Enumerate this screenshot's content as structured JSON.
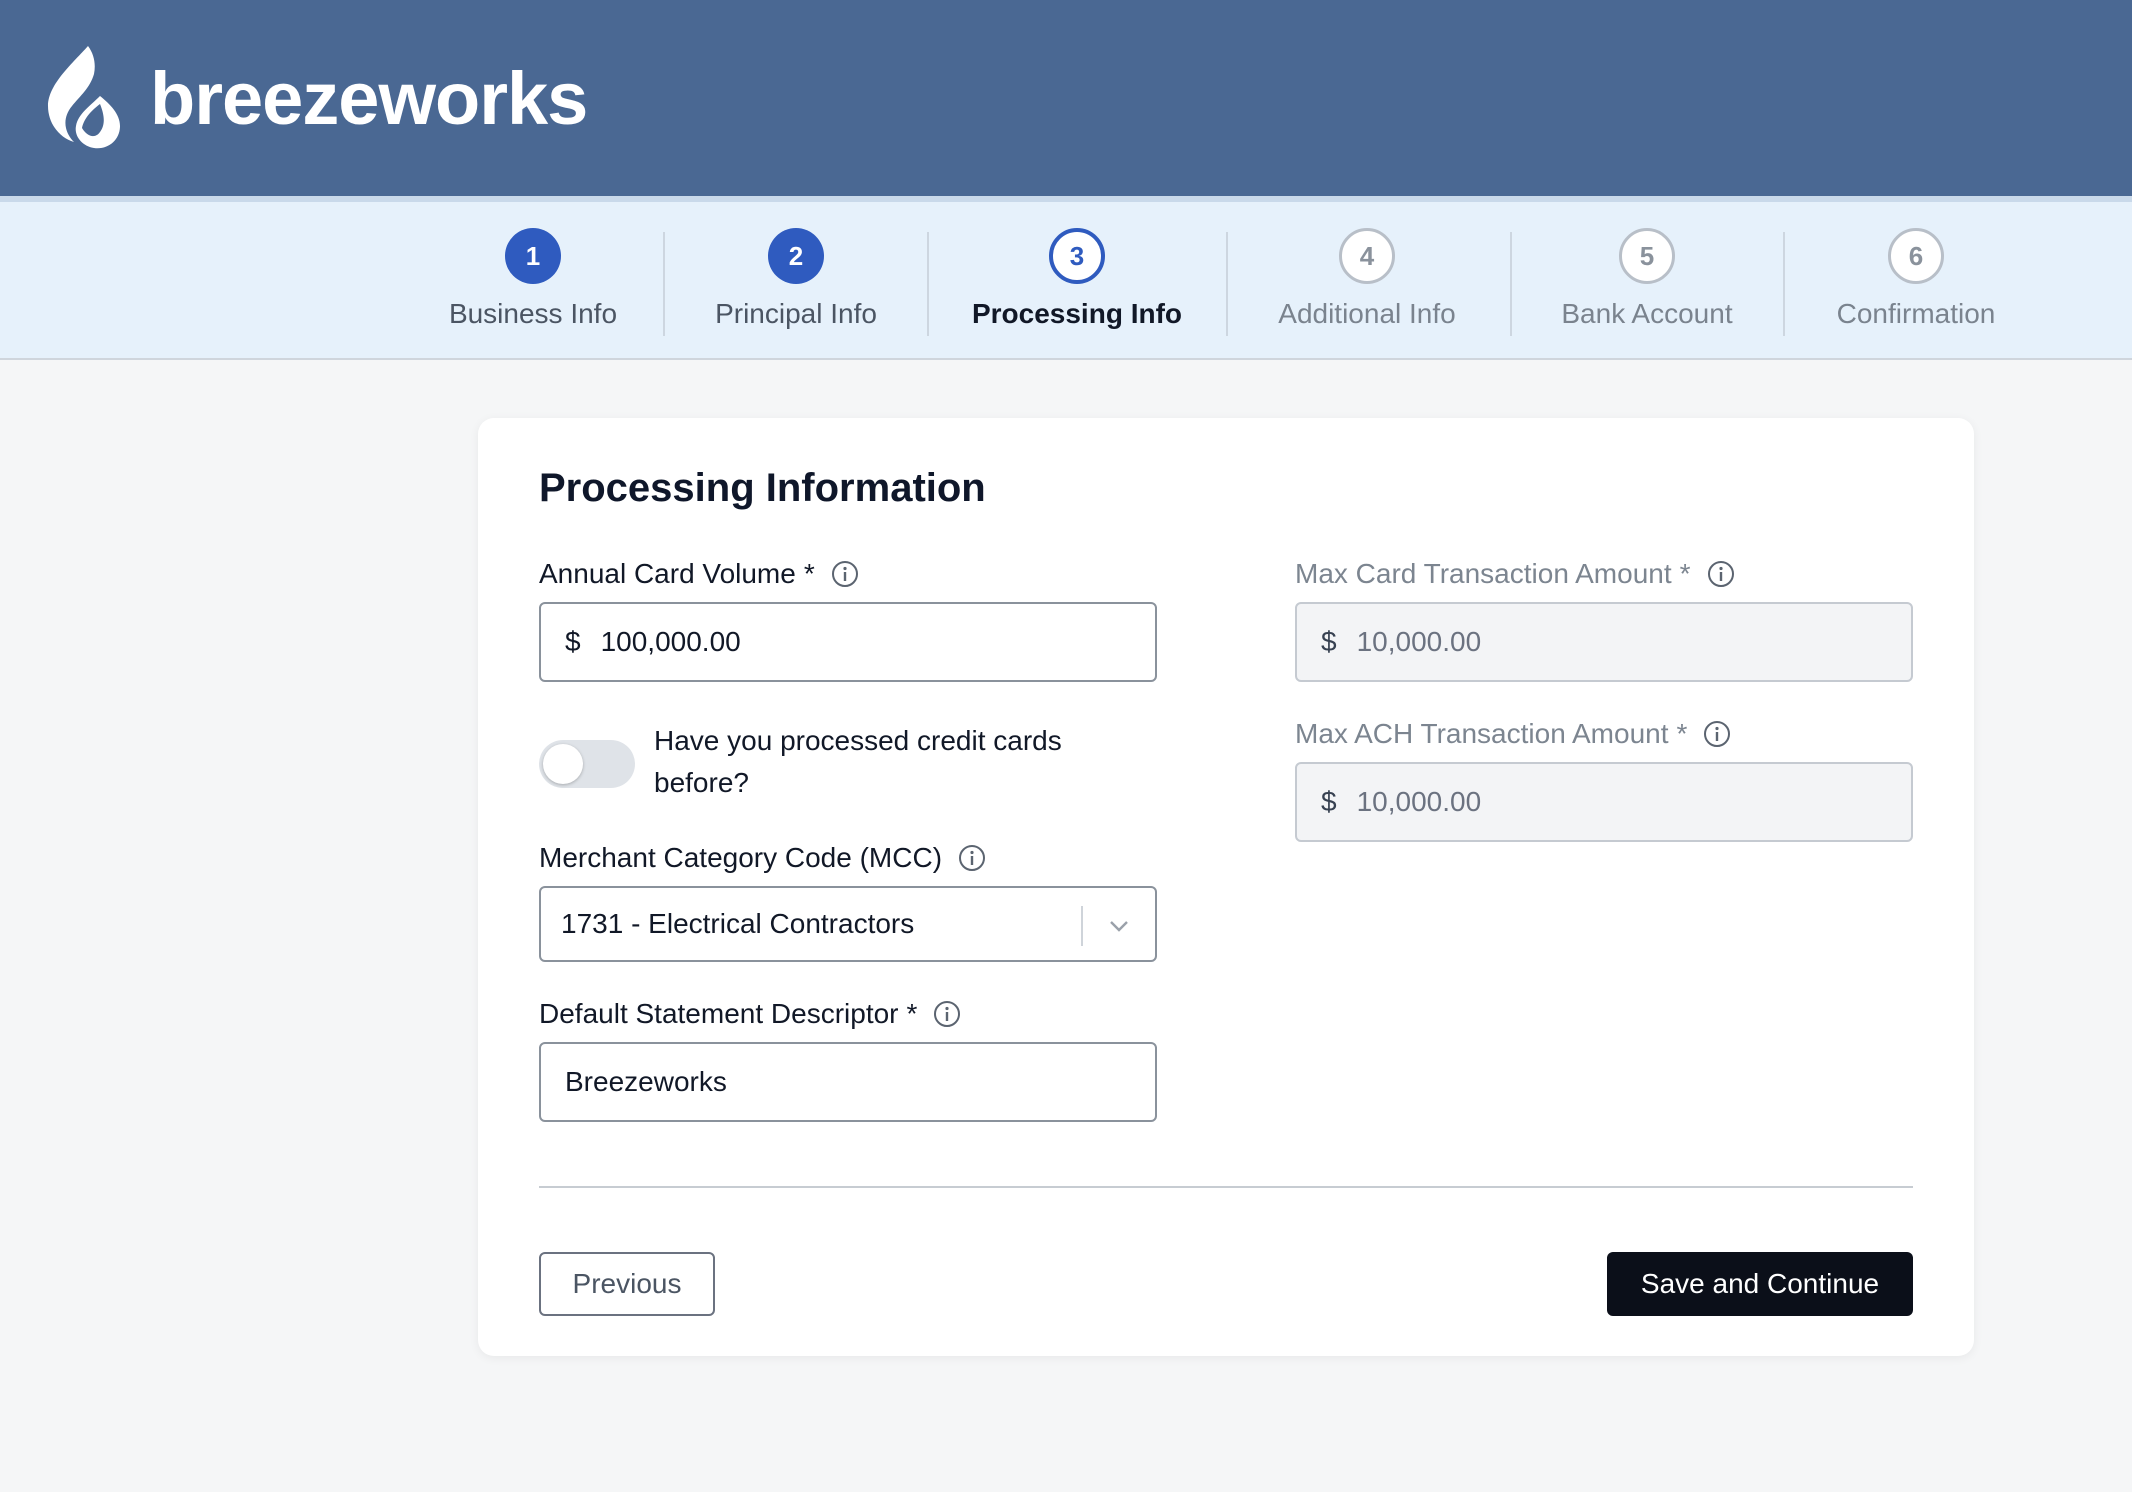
{
  "brand": {
    "name": "breezeworks"
  },
  "stepper": {
    "steps": [
      {
        "number": "1",
        "label": "Business Info",
        "state": "done"
      },
      {
        "number": "2",
        "label": "Principal Info",
        "state": "done"
      },
      {
        "number": "3",
        "label": "Processing Info",
        "state": "current"
      },
      {
        "number": "4",
        "label": "Additional Info",
        "state": "todo"
      },
      {
        "number": "5",
        "label": "Bank Account",
        "state": "todo"
      },
      {
        "number": "6",
        "label": "Confirmation",
        "state": "todo"
      }
    ]
  },
  "form": {
    "title": "Processing Information",
    "annual_card_volume": {
      "label": "Annual Card Volume",
      "required": "*",
      "currency": "$",
      "value": "100,000.00"
    },
    "processed_before": {
      "label": "Have you processed credit cards before?",
      "checked": false
    },
    "mcc": {
      "label": "Merchant Category Code (MCC)",
      "value": "1731 - Electrical Contractors"
    },
    "statement_descriptor": {
      "label": "Default Statement Descriptor",
      "required": "*",
      "value": "Breezeworks"
    },
    "max_card_amount": {
      "label": "Max Card Transaction Amount",
      "required": "*",
      "currency": "$",
      "value": "10,000.00"
    },
    "max_ach_amount": {
      "label": "Max ACH Transaction Amount",
      "required": "*",
      "currency": "$",
      "value": "10,000.00"
    }
  },
  "actions": {
    "previous_label": "Previous",
    "save_label": "Save and Continue"
  },
  "colors": {
    "header": "#4a6893",
    "stepper_bg": "#e6f1fb",
    "accent": "#2f5bbf",
    "primary_button": "#0b0f19"
  },
  "icons": {
    "info": "info-icon",
    "chevron": "chevron-down-icon",
    "logo": "breezeworks-logo-icon"
  }
}
